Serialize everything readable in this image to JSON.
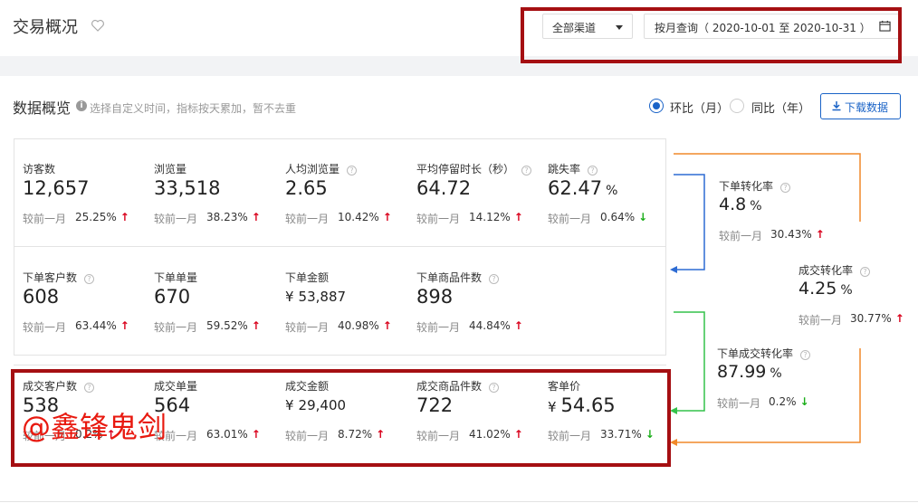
{
  "header": {
    "title": "交易概况",
    "channel_select": "全部渠道",
    "date_range": "按月查询（ 2020-10-01 至 2020-10-31 ）"
  },
  "overview": {
    "title": "数据概览",
    "hint": "选择自定义时间，指标按天累加，暂不去重",
    "radio_mom": "环比（月）",
    "radio_yoy": "同比（年）",
    "download_label": "下载数据"
  },
  "compare_label": "较前一月",
  "metrics": {
    "visitors": {
      "label": "访客数",
      "value": "12,657",
      "pct": "25.25%",
      "trend": "up"
    },
    "page_views": {
      "label": "浏览量",
      "value": "33,518",
      "pct": "38.23%",
      "trend": "up"
    },
    "avg_views": {
      "label": "人均浏览量",
      "value": "2.65",
      "pct": "10.42%",
      "trend": "up"
    },
    "avg_stay": {
      "label": "平均停留时长（秒）",
      "value": "64.72",
      "pct": "14.12%",
      "trend": "up"
    },
    "bounce_rate": {
      "label": "跳失率",
      "value": "62.47",
      "unit": "%",
      "pct": "0.64%",
      "trend": "down"
    },
    "order_customers": {
      "label": "下单客户数",
      "value": "608",
      "pct": "63.44%",
      "trend": "up"
    },
    "order_count": {
      "label": "下单单量",
      "value": "670",
      "pct": "59.52%",
      "trend": "up"
    },
    "order_amount": {
      "label": "下单金额",
      "prefix": "¥",
      "value": "53,887",
      "pct": "40.98%",
      "trend": "up"
    },
    "order_items": {
      "label": "下单商品件数",
      "value": "898",
      "pct": "44.84%",
      "trend": "up"
    },
    "deal_customers": {
      "label": "成交客户数",
      "value": "538",
      "pct": "0.2%",
      "trend": "up"
    },
    "deal_count": {
      "label": "成交单量",
      "value": "564",
      "pct": "63.01%",
      "trend": "up"
    },
    "deal_amount": {
      "label": "成交金额",
      "prefix": "¥",
      "value": "29,400",
      "pct": "8.72%",
      "trend": "up"
    },
    "deal_items": {
      "label": "成交商品件数",
      "value": "722",
      "pct": "41.02%",
      "trend": "up"
    },
    "unit_price": {
      "label": "客单价",
      "prefix": "¥",
      "value": "54.65",
      "pct": "33.71%",
      "trend": "down"
    },
    "order_conv": {
      "label": "下单转化率",
      "value": "4.8",
      "unit": "%",
      "pct": "30.43%",
      "trend": "up"
    },
    "deal_conv": {
      "label": "成交转化率",
      "value": "4.25",
      "unit": "%",
      "pct": "30.77%",
      "trend": "up"
    },
    "order_deal_conv": {
      "label": "下单成交转化率",
      "value": "87.99",
      "unit": "%",
      "pct": "0.2%",
      "trend": "down"
    }
  },
  "watermark": "@鑫锋鬼剑",
  "arrows": {
    "up": "↑",
    "down": "↓"
  },
  "colors": {
    "accent": "#1a63c7",
    "up": "#d9001b",
    "down": "#1aad19",
    "highlight_border": "#a50f12",
    "flow_orange": "#f0892a",
    "flow_blue": "#2d6bd3",
    "flow_green": "#34c24a"
  }
}
